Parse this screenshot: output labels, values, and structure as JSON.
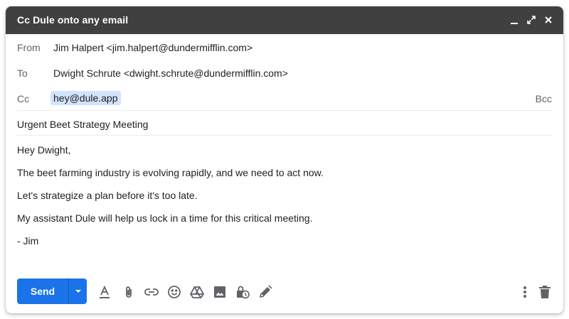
{
  "window": {
    "title": "Cc Dule onto any email"
  },
  "icons": {
    "minimize": "minimize-icon",
    "expand": "expand-icon",
    "close": "close-icon",
    "send_options": "dropdown-arrow-icon",
    "formatting": "text-format-icon",
    "attach": "paperclip-icon",
    "link": "link-icon",
    "emoji": "emoji-icon",
    "drive": "drive-icon",
    "photo": "photo-icon",
    "confidential": "lock-clock-icon",
    "signature": "pen-icon",
    "more": "more-vert-icon",
    "discard": "trash-icon"
  },
  "colors": {
    "titlebar": "#404040",
    "send_button": "#1a73e8",
    "chip_background": "#d2e3fc",
    "label_text": "#5f6368"
  },
  "compose": {
    "from": {
      "label": "From",
      "value": "Jim Halpert <jim.halpert@dundermifflin.com>"
    },
    "to": {
      "label": "To",
      "value": "Dwight Schrute <dwight.schrute@dundermifflin.com>"
    },
    "cc": {
      "label": "Cc",
      "chip": "hey@dule.app",
      "bcc_label": "Bcc"
    },
    "subject": "Urgent Beet Strategy Meeting",
    "body": [
      "Hey Dwight,",
      "The beet farming industry is evolving rapidly, and we need to act now.",
      "Let's strategize a plan before it's too late.",
      "My assistant Dule will help us lock in a time for this critical meeting.",
      "- Jim"
    ]
  },
  "toolbar": {
    "send_label": "Send"
  }
}
